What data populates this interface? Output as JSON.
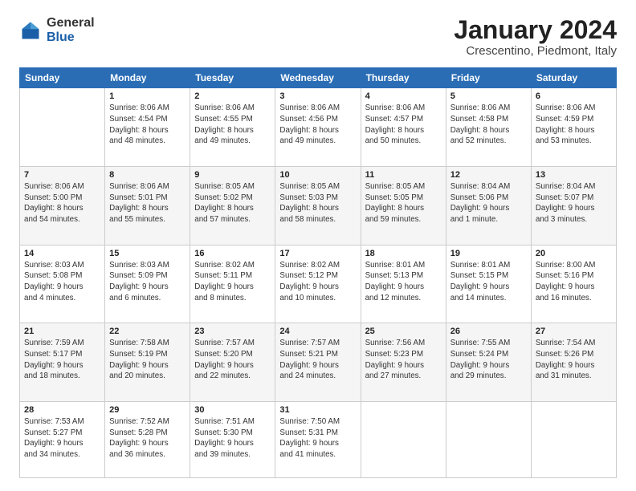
{
  "logo": {
    "general": "General",
    "blue": "Blue"
  },
  "header": {
    "title": "January 2024",
    "subtitle": "Crescentino, Piedmont, Italy"
  },
  "weekdays": [
    "Sunday",
    "Monday",
    "Tuesday",
    "Wednesday",
    "Thursday",
    "Friday",
    "Saturday"
  ],
  "weeks": [
    [
      {
        "day": "",
        "info": ""
      },
      {
        "day": "1",
        "info": "Sunrise: 8:06 AM\nSunset: 4:54 PM\nDaylight: 8 hours\nand 48 minutes."
      },
      {
        "day": "2",
        "info": "Sunrise: 8:06 AM\nSunset: 4:55 PM\nDaylight: 8 hours\nand 49 minutes."
      },
      {
        "day": "3",
        "info": "Sunrise: 8:06 AM\nSunset: 4:56 PM\nDaylight: 8 hours\nand 49 minutes."
      },
      {
        "day": "4",
        "info": "Sunrise: 8:06 AM\nSunset: 4:57 PM\nDaylight: 8 hours\nand 50 minutes."
      },
      {
        "day": "5",
        "info": "Sunrise: 8:06 AM\nSunset: 4:58 PM\nDaylight: 8 hours\nand 52 minutes."
      },
      {
        "day": "6",
        "info": "Sunrise: 8:06 AM\nSunset: 4:59 PM\nDaylight: 8 hours\nand 53 minutes."
      }
    ],
    [
      {
        "day": "7",
        "info": "Sunrise: 8:06 AM\nSunset: 5:00 PM\nDaylight: 8 hours\nand 54 minutes."
      },
      {
        "day": "8",
        "info": "Sunrise: 8:06 AM\nSunset: 5:01 PM\nDaylight: 8 hours\nand 55 minutes."
      },
      {
        "day": "9",
        "info": "Sunrise: 8:05 AM\nSunset: 5:02 PM\nDaylight: 8 hours\nand 57 minutes."
      },
      {
        "day": "10",
        "info": "Sunrise: 8:05 AM\nSunset: 5:03 PM\nDaylight: 8 hours\nand 58 minutes."
      },
      {
        "day": "11",
        "info": "Sunrise: 8:05 AM\nSunset: 5:05 PM\nDaylight: 8 hours\nand 59 minutes."
      },
      {
        "day": "12",
        "info": "Sunrise: 8:04 AM\nSunset: 5:06 PM\nDaylight: 9 hours\nand 1 minute."
      },
      {
        "day": "13",
        "info": "Sunrise: 8:04 AM\nSunset: 5:07 PM\nDaylight: 9 hours\nand 3 minutes."
      }
    ],
    [
      {
        "day": "14",
        "info": "Sunrise: 8:03 AM\nSunset: 5:08 PM\nDaylight: 9 hours\nand 4 minutes."
      },
      {
        "day": "15",
        "info": "Sunrise: 8:03 AM\nSunset: 5:09 PM\nDaylight: 9 hours\nand 6 minutes."
      },
      {
        "day": "16",
        "info": "Sunrise: 8:02 AM\nSunset: 5:11 PM\nDaylight: 9 hours\nand 8 minutes."
      },
      {
        "day": "17",
        "info": "Sunrise: 8:02 AM\nSunset: 5:12 PM\nDaylight: 9 hours\nand 10 minutes."
      },
      {
        "day": "18",
        "info": "Sunrise: 8:01 AM\nSunset: 5:13 PM\nDaylight: 9 hours\nand 12 minutes."
      },
      {
        "day": "19",
        "info": "Sunrise: 8:01 AM\nSunset: 5:15 PM\nDaylight: 9 hours\nand 14 minutes."
      },
      {
        "day": "20",
        "info": "Sunrise: 8:00 AM\nSunset: 5:16 PM\nDaylight: 9 hours\nand 16 minutes."
      }
    ],
    [
      {
        "day": "21",
        "info": "Sunrise: 7:59 AM\nSunset: 5:17 PM\nDaylight: 9 hours\nand 18 minutes."
      },
      {
        "day": "22",
        "info": "Sunrise: 7:58 AM\nSunset: 5:19 PM\nDaylight: 9 hours\nand 20 minutes."
      },
      {
        "day": "23",
        "info": "Sunrise: 7:57 AM\nSunset: 5:20 PM\nDaylight: 9 hours\nand 22 minutes."
      },
      {
        "day": "24",
        "info": "Sunrise: 7:57 AM\nSunset: 5:21 PM\nDaylight: 9 hours\nand 24 minutes."
      },
      {
        "day": "25",
        "info": "Sunrise: 7:56 AM\nSunset: 5:23 PM\nDaylight: 9 hours\nand 27 minutes."
      },
      {
        "day": "26",
        "info": "Sunrise: 7:55 AM\nSunset: 5:24 PM\nDaylight: 9 hours\nand 29 minutes."
      },
      {
        "day": "27",
        "info": "Sunrise: 7:54 AM\nSunset: 5:26 PM\nDaylight: 9 hours\nand 31 minutes."
      }
    ],
    [
      {
        "day": "28",
        "info": "Sunrise: 7:53 AM\nSunset: 5:27 PM\nDaylight: 9 hours\nand 34 minutes."
      },
      {
        "day": "29",
        "info": "Sunrise: 7:52 AM\nSunset: 5:28 PM\nDaylight: 9 hours\nand 36 minutes."
      },
      {
        "day": "30",
        "info": "Sunrise: 7:51 AM\nSunset: 5:30 PM\nDaylight: 9 hours\nand 39 minutes."
      },
      {
        "day": "31",
        "info": "Sunrise: 7:50 AM\nSunset: 5:31 PM\nDaylight: 9 hours\nand 41 minutes."
      },
      {
        "day": "",
        "info": ""
      },
      {
        "day": "",
        "info": ""
      },
      {
        "day": "",
        "info": ""
      }
    ]
  ]
}
